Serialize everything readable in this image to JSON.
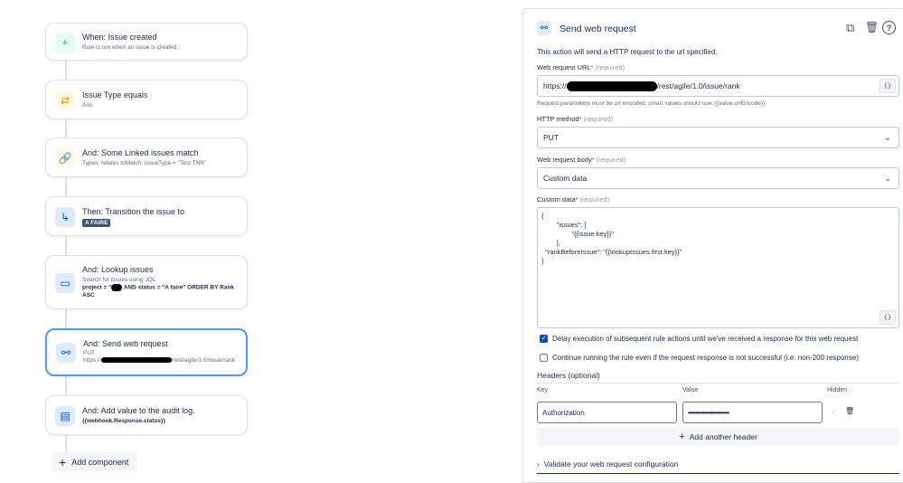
{
  "rule_components": [
    {
      "title": "When: Issue created",
      "subtitle": "Rule is run when an issue is created.",
      "icon": "plus-icon",
      "color": "#36b37e",
      "bg": "#e3fcef"
    },
    {
      "title": "Issue Type equals",
      "subtitle": "Ano",
      "icon": "shuffle-icon",
      "color": "#ff8b00",
      "bg": "#fffae6"
    },
    {
      "title": "And: Some Linked issues match",
      "subtitle": "Types: relates toMatch: issueType = \"Test TNR\"",
      "icon": "link-icon",
      "color": "#ff8b00",
      "bg": "#fffae6"
    },
    {
      "title": "Then: Transition the issue to",
      "status": "A FAIRE",
      "icon": "transition-icon",
      "color": "#0052cc",
      "bg": "#deebff"
    },
    {
      "title": "And: Lookup issues",
      "subtitle": "Search for issues using JQL",
      "jql_prefix": "project = \"",
      "jql_suffix": " AND status = \"A faire\" ORDER BY Rank ASC",
      "icon": "monitor-icon",
      "color": "#0052cc",
      "bg": "#deebff"
    },
    {
      "title": "And: Send web request",
      "method": "PUT",
      "url_prefix": "https://",
      "url_suffix": "/rest/agile/1.0/issue/rank",
      "icon": "webhook-icon",
      "color": "#0052cc",
      "bg": "#deebff"
    },
    {
      "title": "And: Add value to the audit log.",
      "value": "{{webhook.Response.status}}",
      "icon": "document-icon",
      "color": "#0052cc",
      "bg": "#deebff"
    }
  ],
  "add_component_label": "Add component",
  "panel": {
    "title": "Send web request",
    "description": "This action will send a HTTP request to the url specified.",
    "url_label": "Web request URL",
    "required": "(required)",
    "url_prefix": "https://",
    "url_suffix": "/rest/agile/1.0/issue/rank",
    "url_help": "Request parameters must be url encoded, smart values should use: {{value.urlEncode}}.",
    "method_label": "HTTP method",
    "method_value": "PUT",
    "body_label": "Web request body",
    "body_value": "Custom data",
    "custom_label": "Custom data",
    "custom_data_lines": [
      "{",
      "        \"issues\": [",
      "                \"{{issue.key}}\"",
      "        ],",
      "  \"rankBeforeIssue\": \"{{lookupIssues.first.key}}\"",
      "}"
    ],
    "curly": "{}",
    "delay_label": "Delay execution of subsequent rule actions until we've received a response for this web request",
    "delay_checked": true,
    "continue_label": "Continue running the rule even if the request response is not successful (i.e. non-200 response)",
    "continue_checked": false,
    "headers_title": "Headers (optional)",
    "key_col": "Key",
    "value_col": "Value",
    "hidden_col": "Hidden",
    "header_key": "Authorization",
    "header_value": "•••••••••••••••••••••••••",
    "add_header_label": "Add another header",
    "validate_label": "Validate your web request configuration"
  }
}
